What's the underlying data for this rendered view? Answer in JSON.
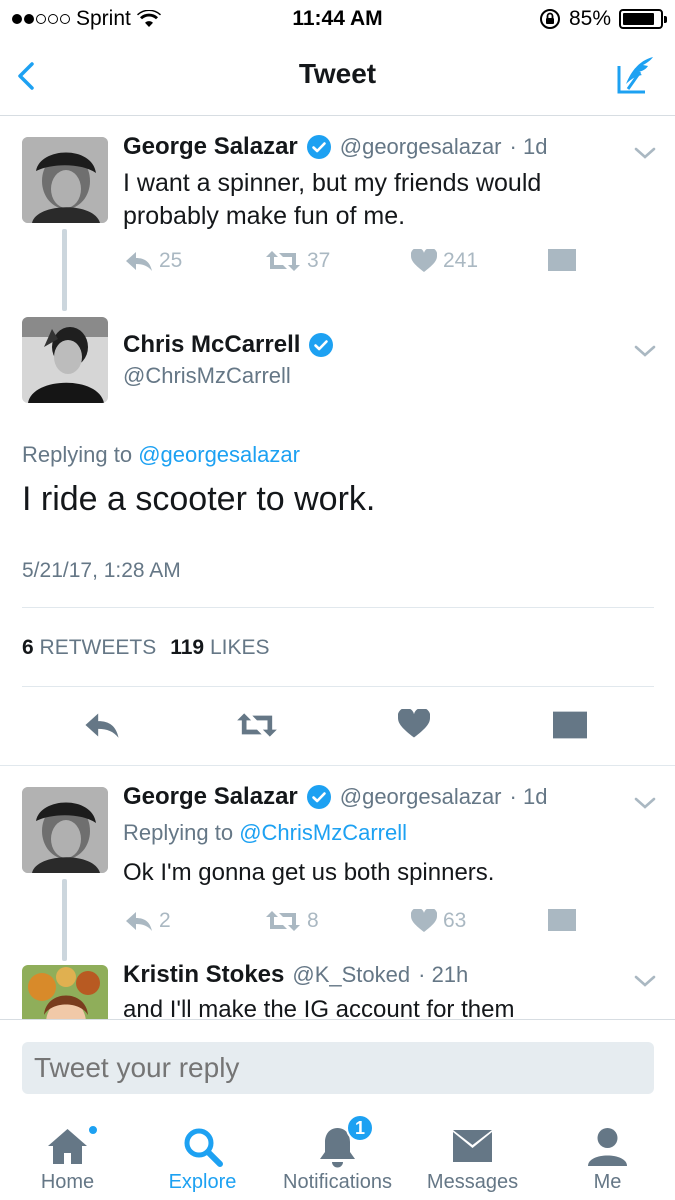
{
  "status": {
    "carrier": "Sprint",
    "time": "11:44 AM",
    "battery": "85%",
    "battery_level": 0.85
  },
  "nav": {
    "title": "Tweet"
  },
  "parent_tweet": {
    "name": "George Salazar",
    "handle": "@georgesalazar",
    "time": "· 1d",
    "text": "I want a spinner, but my friends would probably make fun of me.",
    "replies": "25",
    "retweets": "37",
    "likes": "241"
  },
  "main_tweet": {
    "name": "Chris McCarrell",
    "handle": "@ChrisMzCarrell",
    "reply_prefix": "Replying to",
    "reply_to": "@georgesalazar",
    "text": "I ride a scooter to work.",
    "date": "5/21/17, 1:28 AM",
    "retweet_count": "6",
    "retweet_label": "RETWEETS",
    "like_count": "119",
    "like_label": "LIKES"
  },
  "reply1": {
    "name": "George Salazar",
    "handle": "@georgesalazar",
    "time": "· 1d",
    "reply_prefix": "Replying to",
    "reply_to": "@ChrisMzCarrell",
    "text": "Ok I'm gonna get us both spinners.",
    "replies": "2",
    "retweets": "8",
    "likes": "63"
  },
  "reply2": {
    "name": "Kristin Stokes",
    "handle": "@K_Stoked",
    "time": "· 21h",
    "text": "and I'll make the IG account for them"
  },
  "reply_bar": {
    "placeholder": "Tweet your reply"
  },
  "tabs": [
    {
      "label": "Home",
      "icon": "home-icon"
    },
    {
      "label": "Explore",
      "icon": "search-icon",
      "active": true
    },
    {
      "label": "Notifications",
      "icon": "bell-icon",
      "badge": "1"
    },
    {
      "label": "Messages",
      "icon": "envelope-icon"
    },
    {
      "label": "Me",
      "icon": "person-icon"
    }
  ],
  "colors": {
    "accent": "#1da1f2",
    "muted": "#657786",
    "light_icon": "#aab8c2",
    "verified": "#1da1f2"
  }
}
